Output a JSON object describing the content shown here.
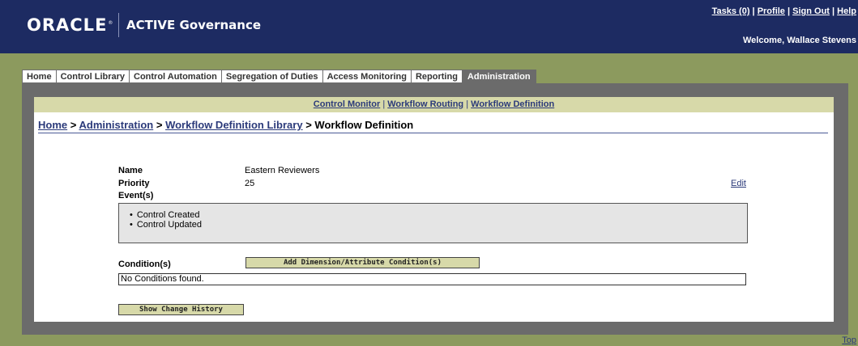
{
  "header": {
    "logo": "ORACLE",
    "logo_mark": "®",
    "product": "ACTIVE Governance",
    "links": [
      "Tasks (0)",
      "Profile",
      "Sign Out",
      "Help"
    ],
    "separator": "|",
    "welcome": "Welcome, Wallace Stevens"
  },
  "tabs": [
    "Home",
    "Control Library",
    "Control Automation",
    "Segregation of Duties",
    "Access Monitoring",
    "Reporting",
    "Administration"
  ],
  "active_tab": "Administration",
  "subnav": {
    "items": [
      "Control Monitor",
      "Workflow Routing",
      "Workflow Definition"
    ],
    "separator": "|"
  },
  "breadcrumb": {
    "links": [
      "Home",
      "Administration",
      "Workflow Definition Library"
    ],
    "current": "Workflow Definition",
    "separator": ">"
  },
  "detail": {
    "name_label": "Name",
    "name_value": "Eastern Reviewers",
    "priority_label": "Priority",
    "priority_value": "25",
    "events_label": "Event(s)",
    "edit_label": "Edit",
    "events": [
      "Control Created",
      "Control Updated"
    ],
    "conditions_label": "Condition(s)",
    "add_condition_button": "Add Dimension/Attribute Condition(s)",
    "no_conditions": "No Conditions found.",
    "history_button": "Show Change History"
  },
  "footer": {
    "top_link": "Top"
  },
  "colors": {
    "header_bg": "#1d2b62",
    "page_bg": "#8c9a5e",
    "frame_bg": "#6b6b6b",
    "accent_bar": "#d7d9a9",
    "link": "#2b3a7a"
  }
}
